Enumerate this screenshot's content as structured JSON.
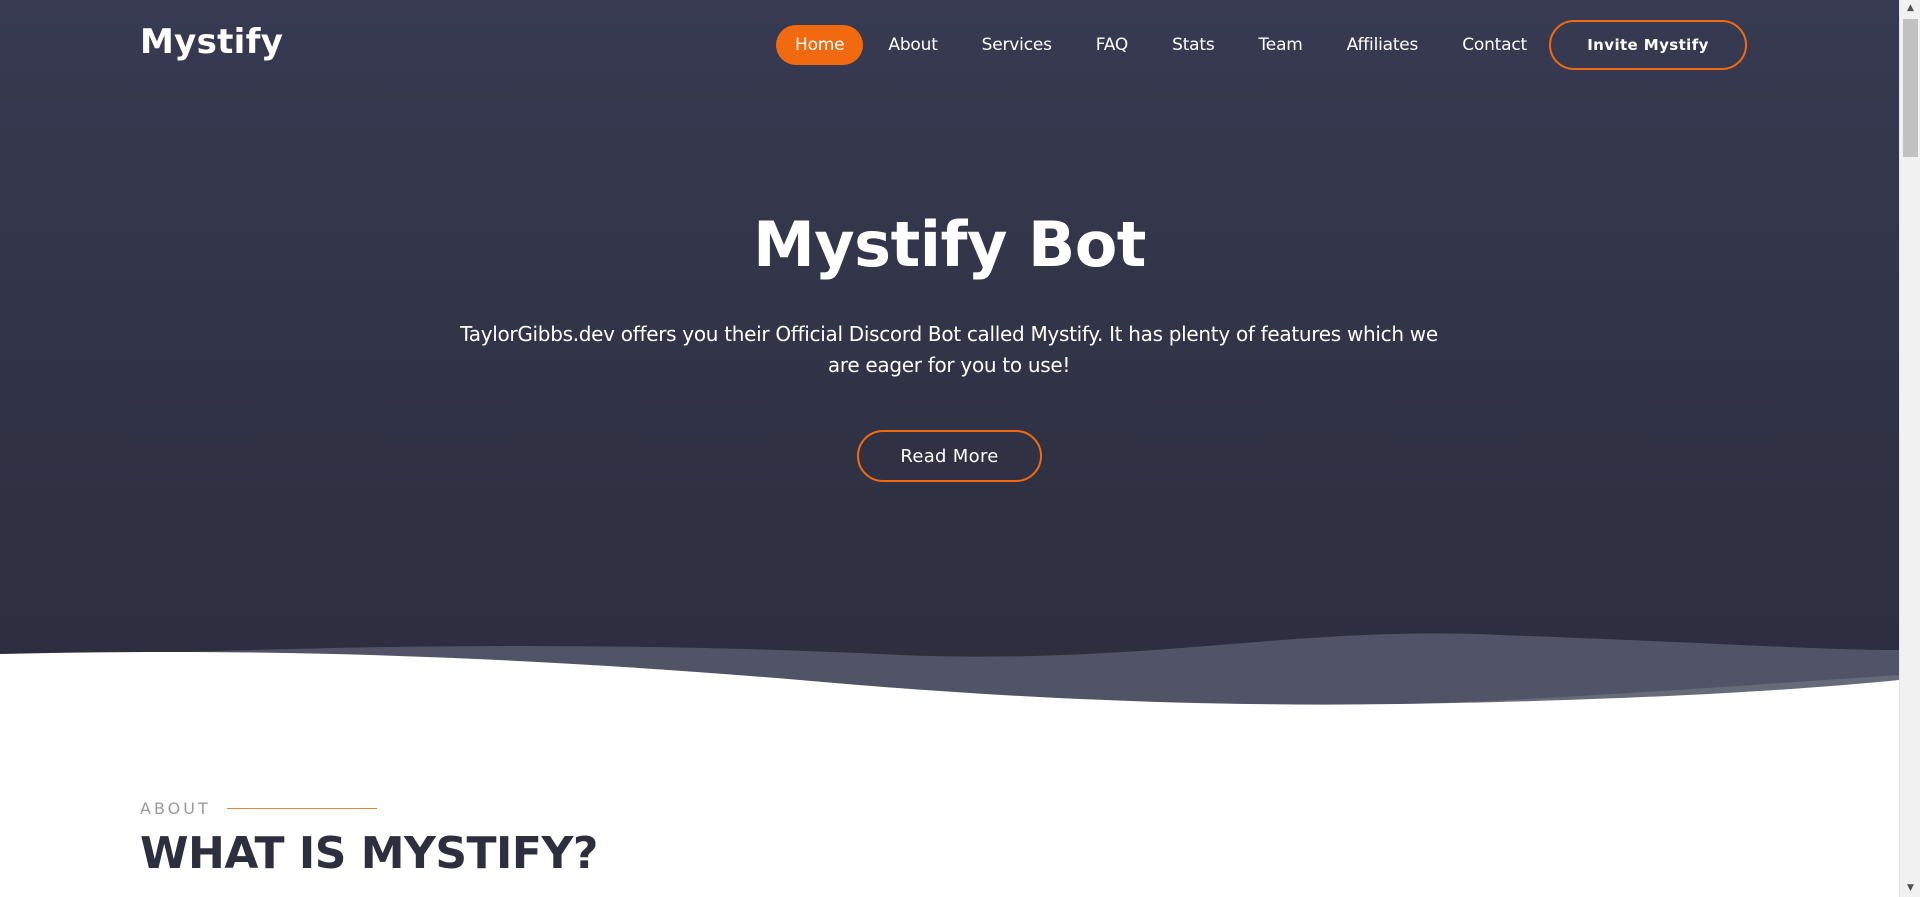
{
  "nav": {
    "logo": "Mystify",
    "items": [
      {
        "label": "Home",
        "active": true
      },
      {
        "label": "About"
      },
      {
        "label": "Services"
      },
      {
        "label": "FAQ"
      },
      {
        "label": "Stats"
      },
      {
        "label": "Team"
      },
      {
        "label": "Affiliates"
      },
      {
        "label": "Contact"
      }
    ],
    "invite_label": "Invite Mystify"
  },
  "hero": {
    "title": "Mystify Bot",
    "text": "TaylorGibbs.dev offers you their Official Discord Bot called Mystify. It has plenty of features which we are eager for you to use!",
    "button_label": "Read More"
  },
  "about": {
    "label": "ABOUT",
    "heading": "WHAT IS MYSTIFY?"
  },
  "colors": {
    "accent": "#f26a10",
    "hero_bg_top": "#373a51",
    "hero_bg_bottom": "#2c2d3d",
    "heading_dark": "#2d2f3f"
  }
}
